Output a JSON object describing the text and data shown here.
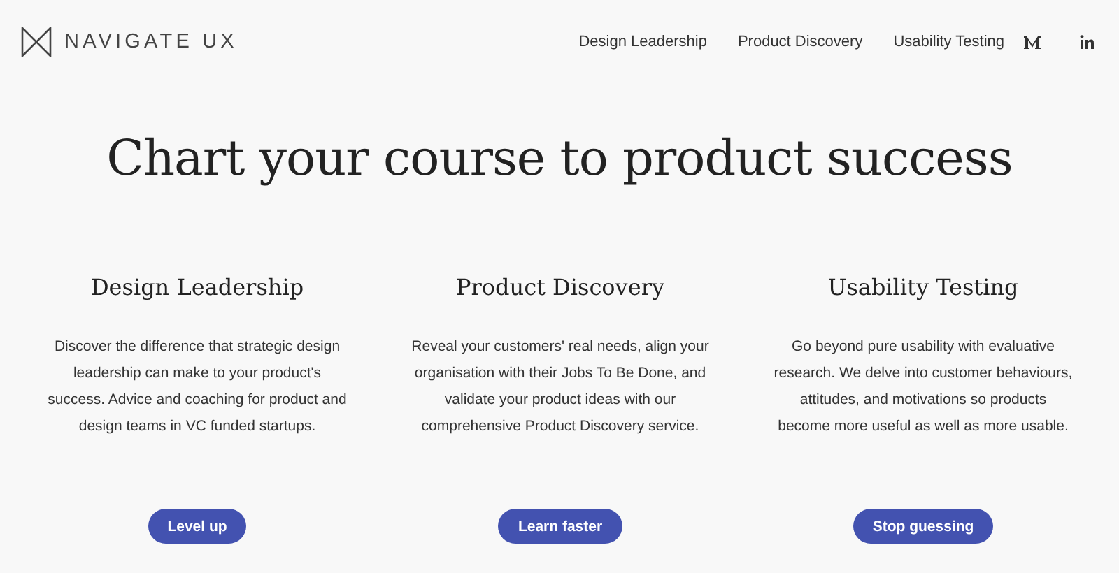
{
  "brand": {
    "name": "NAVIGATE UX"
  },
  "nav": {
    "links": [
      "Design Leadership",
      "Product Discovery",
      "Usability Testing"
    ],
    "social": [
      {
        "kind": "medium"
      },
      {
        "kind": "linkedin"
      }
    ]
  },
  "headline": "Chart your course to product success",
  "services": [
    {
      "title": "Design Leadership",
      "text": "Discover the difference that strategic design leadership can make to your product's success. Advice and coaching for product and design teams in VC funded startups.",
      "button": "Level up"
    },
    {
      "title": "Product Discovery",
      "text": "Reveal your customers' real needs, align your organisation with their Jobs To Be Done, and validate your product ideas with our comprehensive Product Discovery service.",
      "button": "Learn faster"
    },
    {
      "title": "Usability Testing",
      "text": "Go beyond pure usability with evaluative research. We delve into customer behaviours, attitudes, and motivations so products become more useful as well as more usable.",
      "button": "Stop guessing"
    }
  ]
}
